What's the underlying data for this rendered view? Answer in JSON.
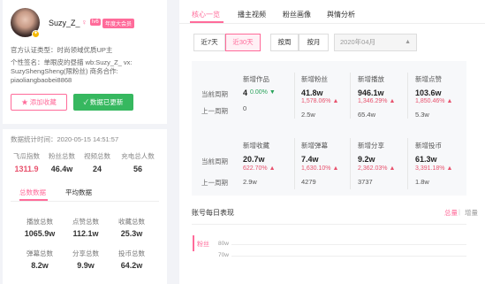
{
  "profile": {
    "username": "Suzy_Z_",
    "gender_symbol": "♀",
    "level": "lv6",
    "vip": "年度大会员",
    "cert": "官方认证类型：时尚领域优质UP主",
    "signature_line1": "个性签名：单眼皮的昼描 wb:Suzy_Z_ vx:",
    "signature_line2": "SuzyShengSheng(限粉丝) 商务合作:",
    "signature_line3": "piaoliangbaobei8868",
    "fav_label": "添加收藏",
    "update_label": "数据已更新",
    "stat_time": "数据统计时间：2020-05-15 14:51:57"
  },
  "stats": {
    "headers": [
      "飞瓜指数",
      "粉丝总数",
      "视频总数",
      "充电总人数"
    ],
    "values": [
      "1311.9",
      "46.4w",
      "24",
      "56"
    ],
    "value_colors": [
      "#e8526d",
      "#333333",
      "#333333",
      "#333333"
    ]
  },
  "tabs2": {
    "items": [
      "总数数据",
      "平均数据"
    ]
  },
  "metrics": {
    "row1_headers": [
      "播放总数",
      "点赞总数",
      "收藏总数"
    ],
    "row1_values": [
      "1065.9w",
      "112.1w",
      "25.3w"
    ],
    "row2_headers": [
      "弹幕总数",
      "分享总数",
      "投币总数"
    ],
    "row2_values": [
      "8.2w",
      "9.9w",
      "64.2w"
    ]
  },
  "nav": {
    "items": [
      "核心一览",
      "播主视频",
      "粉丝画像",
      "舆情分析"
    ]
  },
  "filters": {
    "ranges": [
      "近7天",
      "近30天"
    ],
    "periods": [
      "按周",
      "按月"
    ],
    "month": "2020年04月"
  },
  "core": {
    "current_label": "当前周期",
    "previous_label": "上一周期",
    "row1": [
      {
        "title": "新增作品",
        "current": "4",
        "pct": "0.00%",
        "pct_dir": "down",
        "prev": "0"
      },
      {
        "title": "新增粉丝",
        "current": "41.8w",
        "pct": "1,578.06%",
        "pct_dir": "up",
        "prev": "2.5w"
      },
      {
        "title": "新增播放",
        "current": "946.1w",
        "pct": "1,346.29%",
        "pct_dir": "up",
        "prev": "65.4w"
      },
      {
        "title": "新增点赞",
        "current": "103.6w",
        "pct": "1,850.46%",
        "pct_dir": "up",
        "prev": "5.3w"
      }
    ],
    "row2": [
      {
        "title": "新增收藏",
        "current": "20.7w",
        "pct": "622.70%",
        "pct_dir": "up",
        "prev": "2.9w"
      },
      {
        "title": "新增弹幕",
        "current": "7.4w",
        "pct": "1,630.10%",
        "pct_dir": "up",
        "prev": "4279"
      },
      {
        "title": "新增分享",
        "current": "9.2w",
        "pct": "2,362.03%",
        "pct_dir": "up",
        "prev": "3737"
      },
      {
        "title": "新增投币",
        "current": "61.3w",
        "pct": "3,391.18%",
        "pct_dir": "up",
        "prev": "1.8w"
      }
    ]
  },
  "daily": {
    "title": "账号每日表现",
    "toggle_total": "总量",
    "toggle_increase": "增量",
    "legend": "粉丝",
    "yticks": [
      "80w",
      "70w"
    ]
  },
  "colors": {
    "accent": "#ff6b9a",
    "green": "#36b85f",
    "up": "#e8526d",
    "down": "#29a35a"
  }
}
